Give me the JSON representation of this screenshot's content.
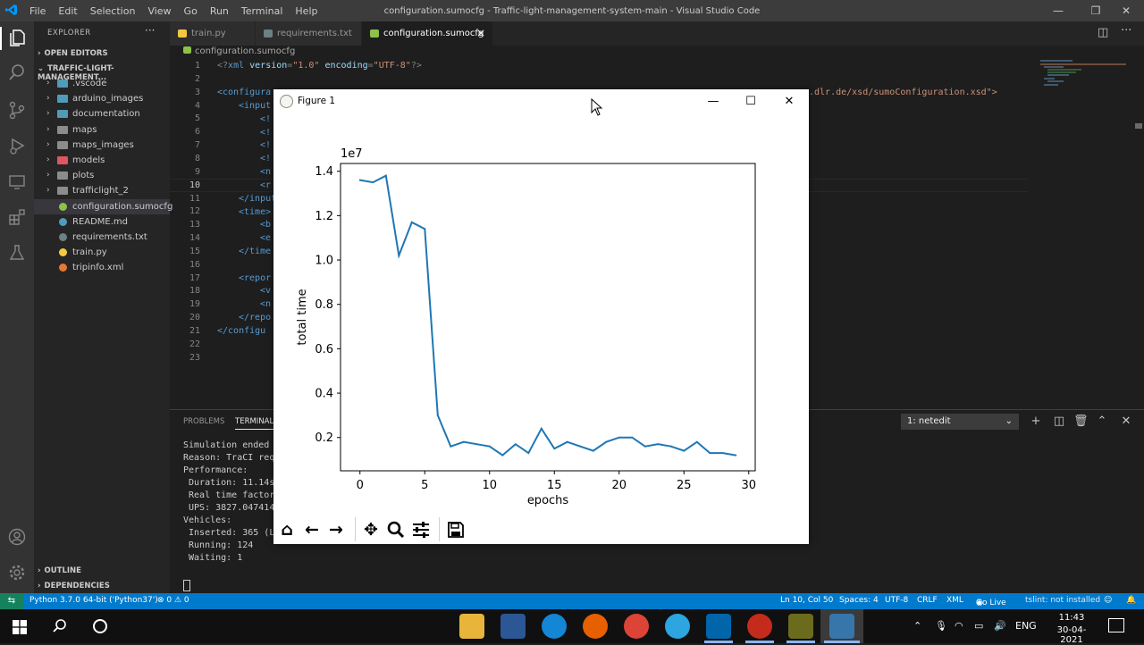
{
  "window": {
    "menu": [
      "File",
      "Edit",
      "Selection",
      "View",
      "Go",
      "Run",
      "Terminal",
      "Help"
    ],
    "title": "configuration.sumocfg - Traffic-light-management-system-main - Visual Studio Code"
  },
  "explorer": {
    "header": "EXPLORER",
    "open_editors": "OPEN EDITORS",
    "project": "TRAFFIC-LIGHT-MANAGEMENT...",
    "items": [
      {
        "label": ".vscode",
        "kind": "folder",
        "color": "#519aba"
      },
      {
        "label": "arduino_images",
        "kind": "folder",
        "color": "#519aba"
      },
      {
        "label": "documentation",
        "kind": "folder",
        "color": "#519aba"
      },
      {
        "label": "maps",
        "kind": "folder",
        "color": "#8c8c8c"
      },
      {
        "label": "maps_images",
        "kind": "folder",
        "color": "#8c8c8c"
      },
      {
        "label": "models",
        "kind": "folder",
        "color": "#e05561"
      },
      {
        "label": "plots",
        "kind": "folder",
        "color": "#8c8c8c"
      },
      {
        "label": "trafficlight_2",
        "kind": "folder",
        "color": "#8c8c8c"
      },
      {
        "label": "configuration.sumocfg",
        "kind": "file",
        "color": "#8dc149"
      },
      {
        "label": "README.md",
        "kind": "file",
        "color": "#519aba"
      },
      {
        "label": "requirements.txt",
        "kind": "file",
        "color": "#6d8086"
      },
      {
        "label": "train.py",
        "kind": "file",
        "color": "#f5c843"
      },
      {
        "label": "tripinfo.xml",
        "kind": "file",
        "color": "#e37933"
      }
    ],
    "outline": "OUTLINE",
    "dependencies": "DEPENDENCIES"
  },
  "tabs": [
    {
      "label": "train.py",
      "color": "#f5c843"
    },
    {
      "label": "requirements.txt",
      "color": "#6d8086"
    },
    {
      "label": "configuration.sumocfg",
      "color": "#8dc149",
      "close": "×"
    }
  ],
  "breadcrumb": "configuration.sumocfg",
  "editor": {
    "line_numbers": [
      "1",
      "2",
      "3",
      "4",
      "5",
      "6",
      "7",
      "8",
      "9",
      "10",
      "11",
      "12",
      "13",
      "14",
      "15",
      "16",
      "17",
      "18",
      "19",
      "20",
      "21",
      "22",
      "23"
    ],
    "current_line": "10",
    "line1": {
      "open": "<?",
      "tag": "xml",
      "a1": "version",
      "v1": "\"1.0\"",
      "a2": "encoding",
      "v2": "\"UTF-8\"",
      "close": "?>"
    },
    "line3_left": "<configura",
    "line3_right": ".dlr.de/xsd/sumoConfiguration.xsd\">",
    "fragments": {
      "l4": "<input",
      "l5": "<!",
      "l6": "<!",
      "l7": "<!",
      "l8": "<!",
      "l9": "<n",
      "l10": "<r",
      "l11": "</input",
      "l12": "<time>",
      "l13": "<b",
      "l14": "<e",
      "l15": "</time",
      "l17": "<repor",
      "l18": "<v",
      "l19": "<n",
      "l20": "</repo",
      "l21": "</configu"
    }
  },
  "panel": {
    "tabs": [
      "PROBLEMS",
      "TERMINAL"
    ],
    "terminal_select": "1: netedit",
    "lines": [
      "Simulation ended a",
      "Reason: TraCI requ",
      "Performance:",
      " Duration: 11.14s",
      " Real time factor:",
      " UPS: 3827.047414",
      "Vehicles:",
      " Inserted: 365 (Lo",
      " Running: 124",
      " Waiting: 1"
    ]
  },
  "statusbar": {
    "python": "Python 3.7.0 64-bit ('Python37')",
    "problems": "⊗ 0 ⚠ 0",
    "position": "Ln 10, Col 50",
    "spaces": "Spaces: 4",
    "encoding": "UTF-8",
    "eol": "CRLF",
    "language": "XML",
    "golive": "Go Live",
    "notinstalled": "tslint: not installed"
  },
  "taskbar": {
    "lang": "ENG",
    "time": "11:43",
    "date": "30-04-2021"
  },
  "figure": {
    "title": "Figure 1",
    "toolbar": [
      "home-icon",
      "back-icon",
      "forward-icon",
      "pan-icon",
      "zoom-icon",
      "configure-icon",
      "save-icon"
    ]
  },
  "chart_data": {
    "type": "line",
    "xlabel": "epochs",
    "ylabel": "total time",
    "offset_label": "1e7",
    "xlim": [
      -1.5,
      30.5
    ],
    "ylim": [
      0.05,
      1.435
    ],
    "xticks": [
      0,
      5,
      10,
      15,
      20,
      25,
      30
    ],
    "yticks": [
      0.2,
      0.4,
      0.6,
      0.8,
      1.0,
      1.2,
      1.4
    ],
    "ytick_labels": [
      "0.2",
      "0.4",
      "0.6",
      "0.8",
      "1.0",
      "1.2",
      "1.4"
    ],
    "line_color": "#1f77b4",
    "x": [
      0,
      1,
      2,
      3,
      4,
      5,
      6,
      7,
      8,
      9,
      10,
      11,
      12,
      13,
      14,
      15,
      16,
      17,
      18,
      19,
      20,
      21,
      22,
      23,
      24,
      25,
      26,
      27,
      28,
      29
    ],
    "values": [
      1.36,
      1.35,
      1.38,
      1.02,
      1.17,
      1.14,
      0.3,
      0.16,
      0.18,
      0.17,
      0.16,
      0.12,
      0.17,
      0.13,
      0.24,
      0.15,
      0.18,
      0.16,
      0.14,
      0.18,
      0.2,
      0.2,
      0.16,
      0.17,
      0.16,
      0.14,
      0.18,
      0.13,
      0.13,
      0.12
    ]
  }
}
